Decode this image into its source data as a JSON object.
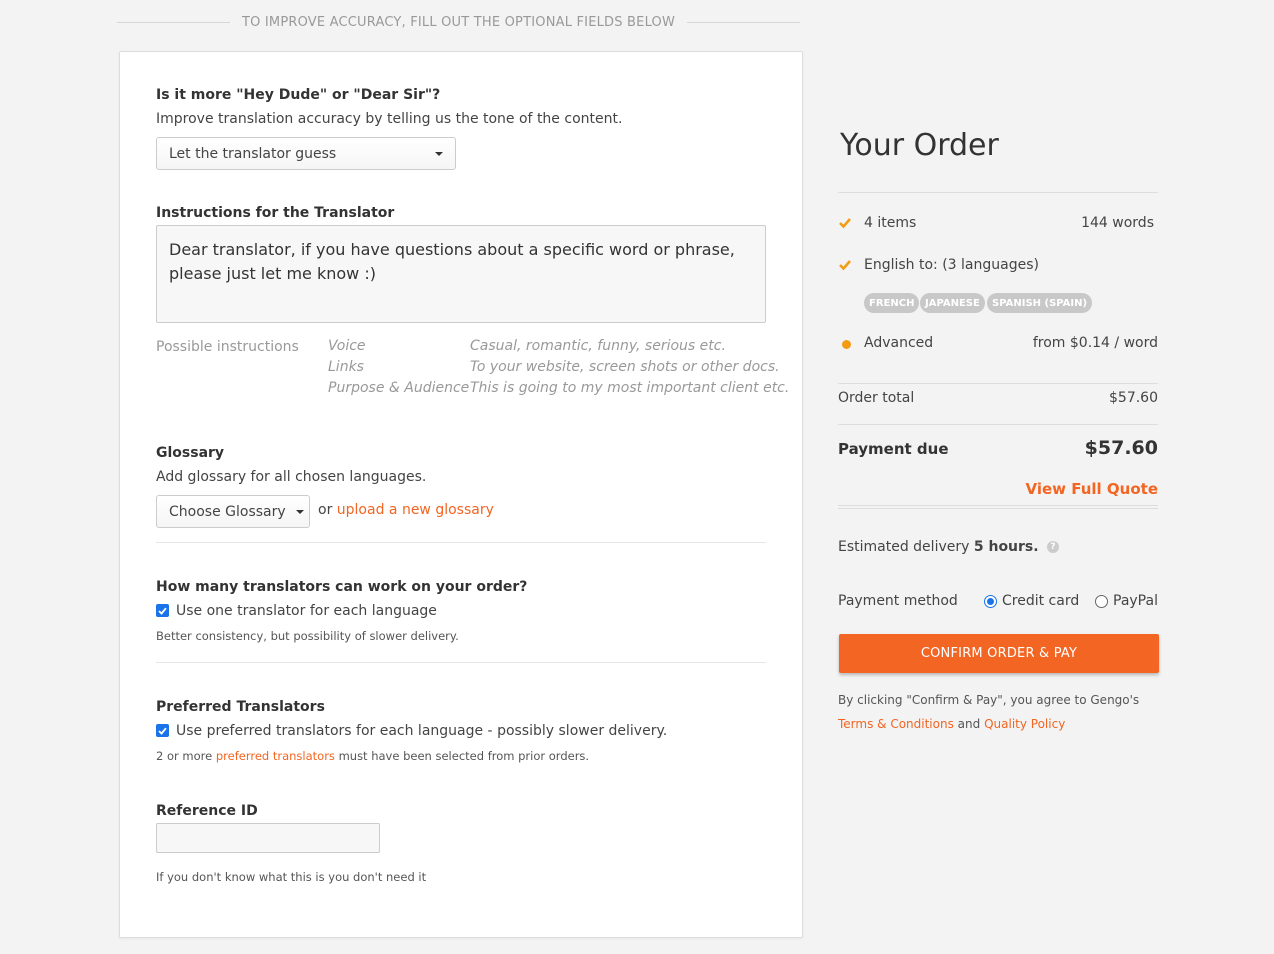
{
  "banner": "To improve accuracy, fill out the optional fields below",
  "tone": {
    "title": "Is it more \"Hey Dude\" or \"Dear Sir\"?",
    "subtitle": "Improve translation accuracy by telling us the tone of the content.",
    "selected": "Let the translator guess"
  },
  "instructions": {
    "title": "Instructions for the Translator",
    "value": "Dear translator, if you have questions about a specific word or phrase, please just let me know :)",
    "hint_label": "Possible instructions",
    "hints": [
      {
        "key": "Voice",
        "value": "Casual, romantic, funny, serious etc."
      },
      {
        "key": "Links",
        "value": "To your website, screen shots or other docs."
      },
      {
        "key": "Purpose & Audience",
        "value": "This is going to my most important client etc."
      }
    ]
  },
  "glossary": {
    "title": "Glossary",
    "subtitle": "Add glossary for all chosen languages.",
    "selected": "Choose Glossary",
    "or_text": "or",
    "upload_link": "upload a new glossary"
  },
  "translators": {
    "title": "How many translators can work on your order?",
    "checkbox_label": "Use one translator for each language",
    "checked": true,
    "note": "Better consistency, but possibility of slower delivery."
  },
  "preferred": {
    "title": "Preferred Translators",
    "checkbox_label": "Use preferred translators for each language - possibly slower delivery.",
    "checked": true,
    "note_before": "2 or more",
    "note_link": "preferred translators",
    "note_after": "must have been selected from prior orders."
  },
  "reference": {
    "title": "Reference ID",
    "value": "",
    "note": "If you don't know what this is you don't need it"
  },
  "order": {
    "title": "Your Order",
    "items_label": "4 items",
    "words": "144 words",
    "languages_label": "English to: (3 languages)",
    "languages": [
      "French",
      "Japanese",
      "Spanish (Spain)"
    ],
    "tier_label": "Advanced",
    "tier_price": "from $0.14 / word",
    "total_label": "Order total",
    "total_value": "$57.60",
    "due_label": "Payment due",
    "due_value": "$57.60",
    "quote_link": "View Full Quote",
    "delivery_prefix": "Estimated delivery",
    "delivery_value": "5 hours.",
    "help_glyph": "?",
    "payment_label": "Payment method",
    "payment_options": [
      "Credit card",
      "PayPal"
    ],
    "payment_selected": "Credit card",
    "confirm_button": "Confirm Order & Pay",
    "terms_prefix": "By clicking \"Confirm & Pay\", you agree to Gengo's",
    "terms_link": "Terms & Conditions",
    "terms_and": "and",
    "policy_link": "Quality Policy"
  },
  "colors": {
    "accent": "#f26522",
    "check": "#f39c12",
    "checkbox": "#1a73e8"
  }
}
